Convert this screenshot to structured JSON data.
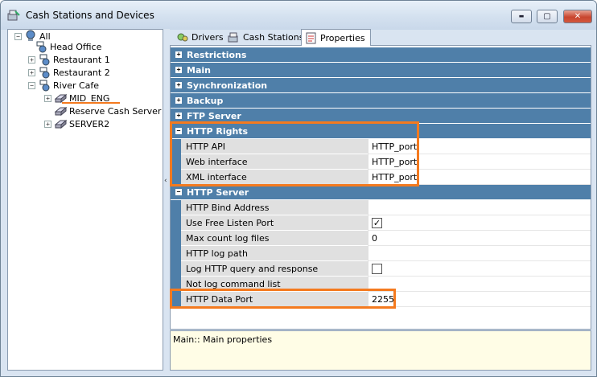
{
  "window": {
    "title": "Cash Stations and Devices",
    "controls": {
      "minimize": "▬",
      "maximize": "▢",
      "close": "✕"
    }
  },
  "tree": {
    "items": [
      {
        "label": "All",
        "icon": "network-icon"
      },
      {
        "label": "Head Office",
        "icon": "node-icon"
      },
      {
        "label": "Restaurant 1",
        "icon": "node-icon"
      },
      {
        "label": "Restaurant 2",
        "icon": "node-icon"
      },
      {
        "label": "River Cafe",
        "icon": "node-icon"
      },
      {
        "label": "MID_ENG",
        "icon": "server-icon"
      },
      {
        "label": "Reserve Cash Server",
        "icon": "server-icon"
      },
      {
        "label": "SERVER2",
        "icon": "server-icon"
      }
    ],
    "expander": {
      "collapsed": "+",
      "expanded": "−"
    }
  },
  "splitter": {
    "arrow": "‹"
  },
  "tabs": [
    {
      "label": "Drivers",
      "icon": "drivers-icon"
    },
    {
      "label": "Cash Stations",
      "icon": "cash-stations-icon"
    },
    {
      "label": "Properties",
      "icon": "properties-icon"
    }
  ],
  "grid": {
    "categories": {
      "restrictions": "Restrictions",
      "main": "Main",
      "synchronization": "Synchronization",
      "backup": "Backup",
      "ftp_server": "FTP Server",
      "http_rights": "HTTP Rights",
      "http_server": "HTTP Server"
    },
    "collapsed_sign": "+",
    "expanded_sign": "−",
    "http_rights": [
      {
        "name": "HTTP API",
        "value": "HTTP_port"
      },
      {
        "name": "Web interface",
        "value": "HTTP_port"
      },
      {
        "name": "XML interface",
        "value": "HTTP_port"
      }
    ],
    "http_server": [
      {
        "name": "HTTP Bind Address",
        "value": ""
      },
      {
        "name": "Use Free Listen Port",
        "value": "",
        "checked": true
      },
      {
        "name": "Max count log files",
        "value": "0"
      },
      {
        "name": "HTTP log path",
        "value": ""
      },
      {
        "name": "Log HTTP query and response",
        "value": "",
        "checked": false
      },
      {
        "name": "Not log command list",
        "value": ""
      },
      {
        "name": "HTTP Data Port",
        "value": "2255"
      }
    ],
    "checkmark": "✓",
    "scroll": {
      "left": "◀",
      "right": "▶"
    }
  },
  "description": {
    "text": "Main:: Main properties"
  },
  "colors": {
    "accent_header": "#4f7fa9",
    "highlight": "#f47a1f"
  }
}
